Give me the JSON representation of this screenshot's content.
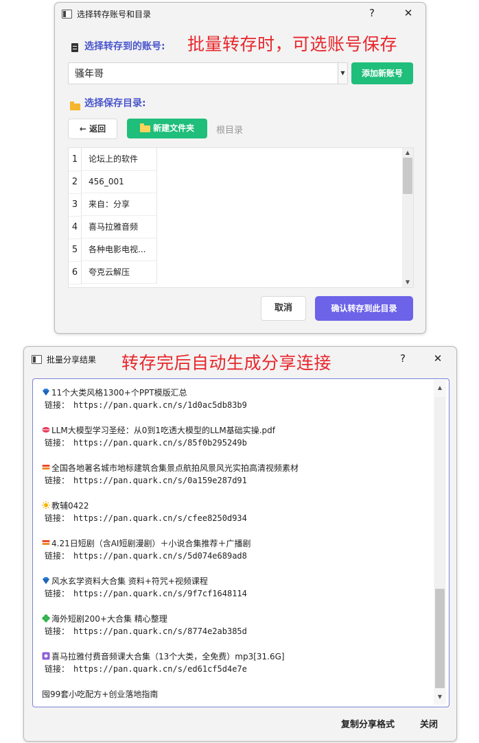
{
  "colors": {
    "accent_purple": "#6c63e8",
    "accent_green": "#1fbe7a",
    "label_blue": "#4a56cc",
    "annotation_red": "#e8262b"
  },
  "dialog1": {
    "title": "选择转存账号和目录",
    "help_btn": "?",
    "close_btn": "✕",
    "account_label": "选择转存到的账号:",
    "annotation": "批量转存时，可选账号保存",
    "account_value": "骚年哥",
    "add_account_btn": "添加新账号",
    "dir_label": "选择保存目录:",
    "back_btn": "← 返回",
    "new_folder_btn": "新建文件夹",
    "breadcrumb": "根目录",
    "folders": [
      {
        "num": "1",
        "name": "论坛上的软件"
      },
      {
        "num": "2",
        "name": "456_001"
      },
      {
        "num": "3",
        "name": "来自：分享"
      },
      {
        "num": "4",
        "name": "喜马拉雅音频"
      },
      {
        "num": "5",
        "name": "各种电影电视..."
      },
      {
        "num": "6",
        "name": "夸克云解压"
      }
    ],
    "cancel_btn": "取消",
    "confirm_btn": "确认转存到此目录"
  },
  "dialog2": {
    "title": "批量分享结果",
    "annotation": "转存完后自动生成分享连接",
    "help_btn": "?",
    "close_btn": "✕",
    "link_prefix": "链接：",
    "results": [
      {
        "icon": "diamond-icon",
        "title": "11个大类风格1300+个PPT模版汇总",
        "link": "https://pan.quark.cn/s/1d0ac5db83b9"
      },
      {
        "icon": "lips-icon",
        "title": "LLM大模型学习圣经：从0到1吃透大模型的LLM基础实操.pdf",
        "link": "https://pan.quark.cn/s/85f0b295249b"
      },
      {
        "icon": "stack-icon",
        "title": "全国各地著名城市地标建筑合集景点航拍风景风光实拍高清视频素材",
        "link": "https://pan.quark.cn/s/0a159e287d91"
      },
      {
        "icon": "sun-icon",
        "title": "教辅0422",
        "link": "https://pan.quark.cn/s/cfee8250d934"
      },
      {
        "icon": "stack-icon",
        "title": "4.21日短剧（含AI短剧漫剧）＋小说合集推荐＋广播剧",
        "link": "https://pan.quark.cn/s/5d074e689ad8"
      },
      {
        "icon": "diamond-icon",
        "title": "风水玄学资料大合集 资料+符咒+视频课程",
        "link": "https://pan.quark.cn/s/9f7cf1648114"
      },
      {
        "icon": "clover-icon",
        "title": "海外短剧200+大合集 精心整理",
        "link": "https://pan.quark.cn/s/8774e2ab385d"
      },
      {
        "icon": "box-icon",
        "title": "喜马拉雅付费音频课大合集（13个大类，全免费）mp3[31.6G]",
        "link": "https://pan.quark.cn/s/ed61cf5d4e7e"
      },
      {
        "icon": "",
        "title": "囤99套小吃配方+创业落地指南",
        "link": ""
      }
    ],
    "copy_btn": "复制分享格式",
    "close_text_btn": "关闭"
  }
}
